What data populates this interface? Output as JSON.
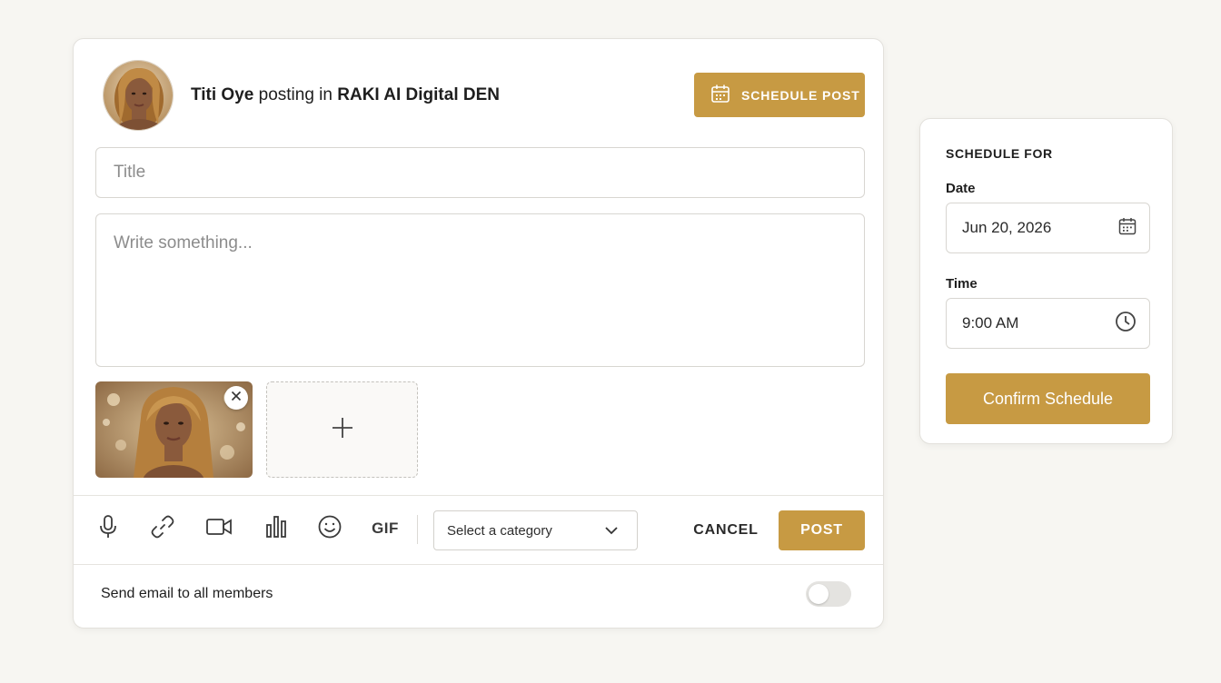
{
  "header": {
    "author": "Titi Oye",
    "connector": "posting in",
    "group": "RAKI AI Digital DEN",
    "schedule_post_label": "SCHEDULE POST"
  },
  "form": {
    "title_placeholder": "Title",
    "body_placeholder": "Write something..."
  },
  "toolbar": {
    "icons": [
      "microphone-icon",
      "link-icon",
      "video-icon",
      "poll-icon",
      "emoji-icon"
    ],
    "gif_label": "GIF",
    "category_selected": "Select a category",
    "cancel_label": "CANCEL",
    "post_label": "POST"
  },
  "email": {
    "label": "Send email to all members",
    "enabled": false
  },
  "schedule": {
    "heading": "SCHEDULE FOR",
    "date_label": "Date",
    "date_value": "Jun 20, 2026",
    "time_label": "Time",
    "time_value": "9:00 AM",
    "confirm_label": "Confirm Schedule"
  },
  "colors": {
    "accent": "#c79a43",
    "background": "#f7f6f2",
    "border": "#d8d6d1"
  }
}
